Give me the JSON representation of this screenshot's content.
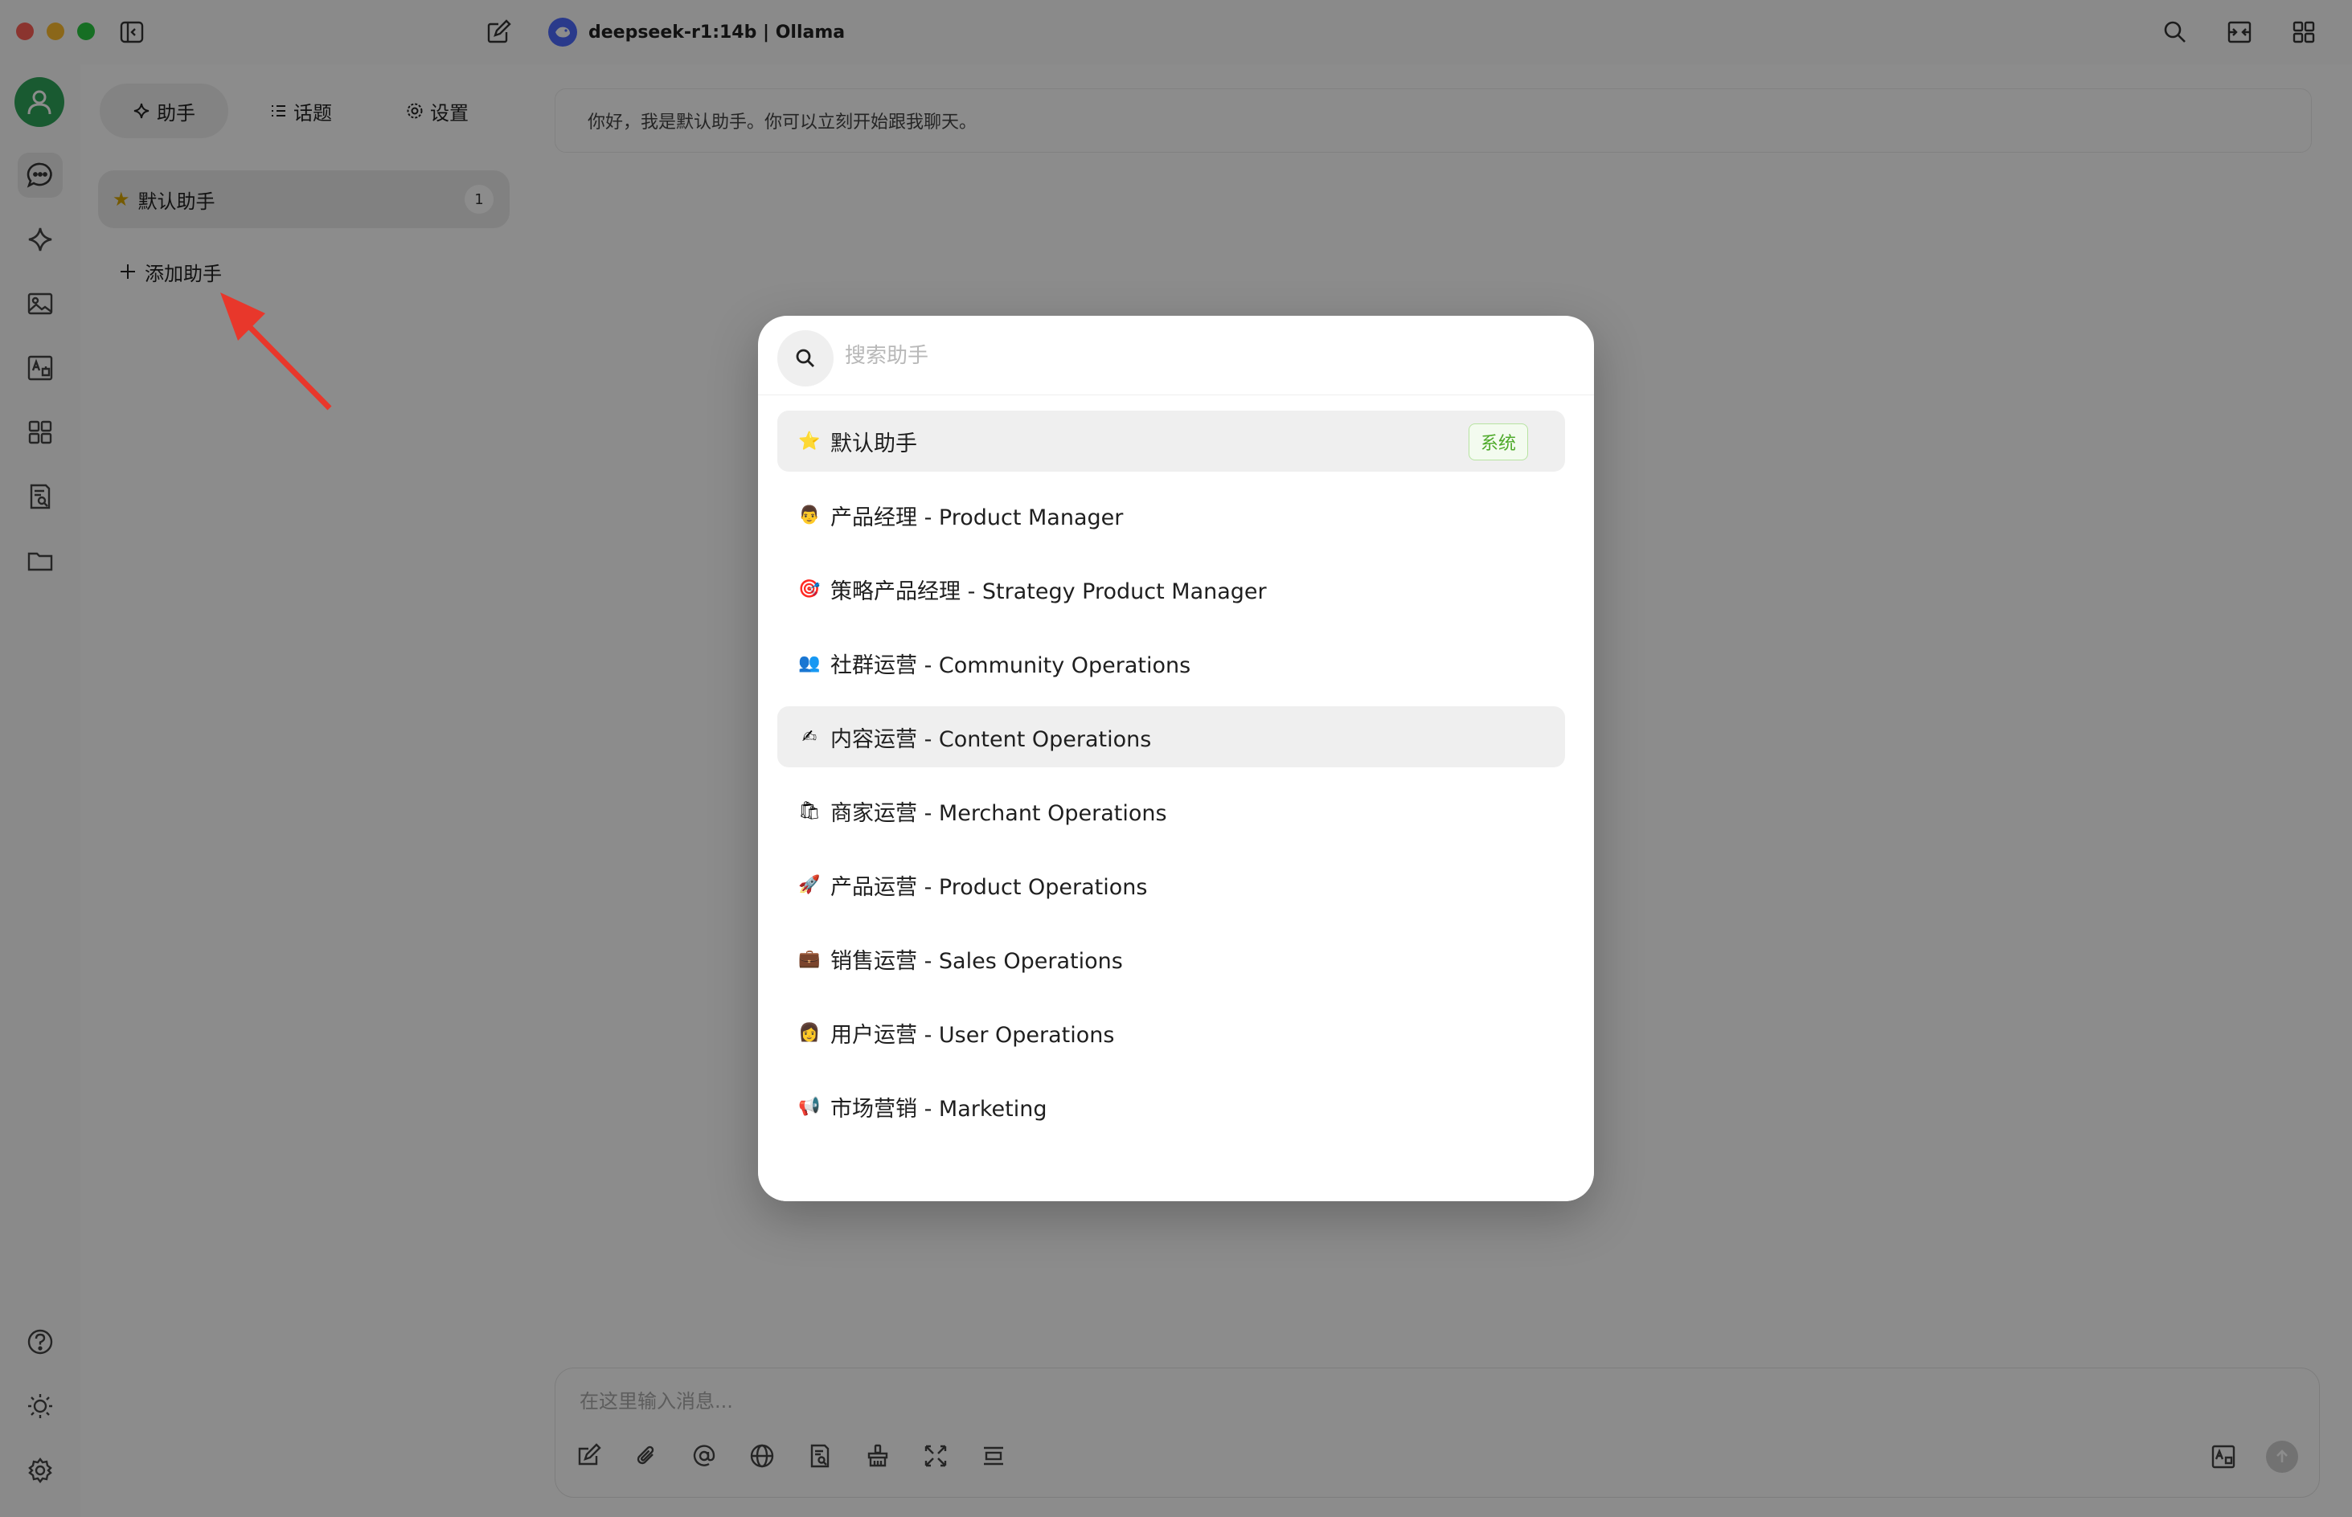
{
  "window": {
    "model_title": "deepseek-r1:14b | Ollama",
    "traffic_colors": [
      "#fe5f57",
      "#febc2e",
      "#28c840"
    ]
  },
  "panel": {
    "tabs": [
      {
        "label": "助手",
        "icon": "sparkle-icon"
      },
      {
        "label": "话题",
        "icon": "list-icon"
      },
      {
        "label": "设置",
        "icon": "gear-icon"
      }
    ],
    "assistant": {
      "emoji": "★",
      "label": "默认助手",
      "count": "1"
    },
    "add_label": "添加助手"
  },
  "main": {
    "greeting": "你好，我是默认助手。你可以立刻开始跟我聊天。",
    "input_placeholder": "在这里输入消息..."
  },
  "modal": {
    "search_placeholder": "搜索助手",
    "items": [
      {
        "emoji": "⭐",
        "label": "默认助手",
        "tag": "系统"
      },
      {
        "emoji": "👨",
        "label": "产品经理 - Product Manager"
      },
      {
        "emoji": "🎯",
        "label": "策略产品经理 - Strategy Product Manager"
      },
      {
        "emoji": "👥",
        "label": "社群运营 - Community Operations"
      },
      {
        "emoji": "✍",
        "label": "内容运营 - Content Operations"
      },
      {
        "emoji": "🛍",
        "label": "商家运营 - Merchant Operations"
      },
      {
        "emoji": "🚀",
        "label": "产品运营 - Product Operations"
      },
      {
        "emoji": "💼",
        "label": "销售运营 - Sales Operations"
      },
      {
        "emoji": "👩",
        "label": "用户运营 - User Operations"
      },
      {
        "emoji": "📢",
        "label": "市场营销 - Marketing"
      }
    ]
  },
  "colors": {
    "avatar": "#2fa45a",
    "arrow": "#e8372b",
    "system_tag": "#4eaa2a"
  }
}
